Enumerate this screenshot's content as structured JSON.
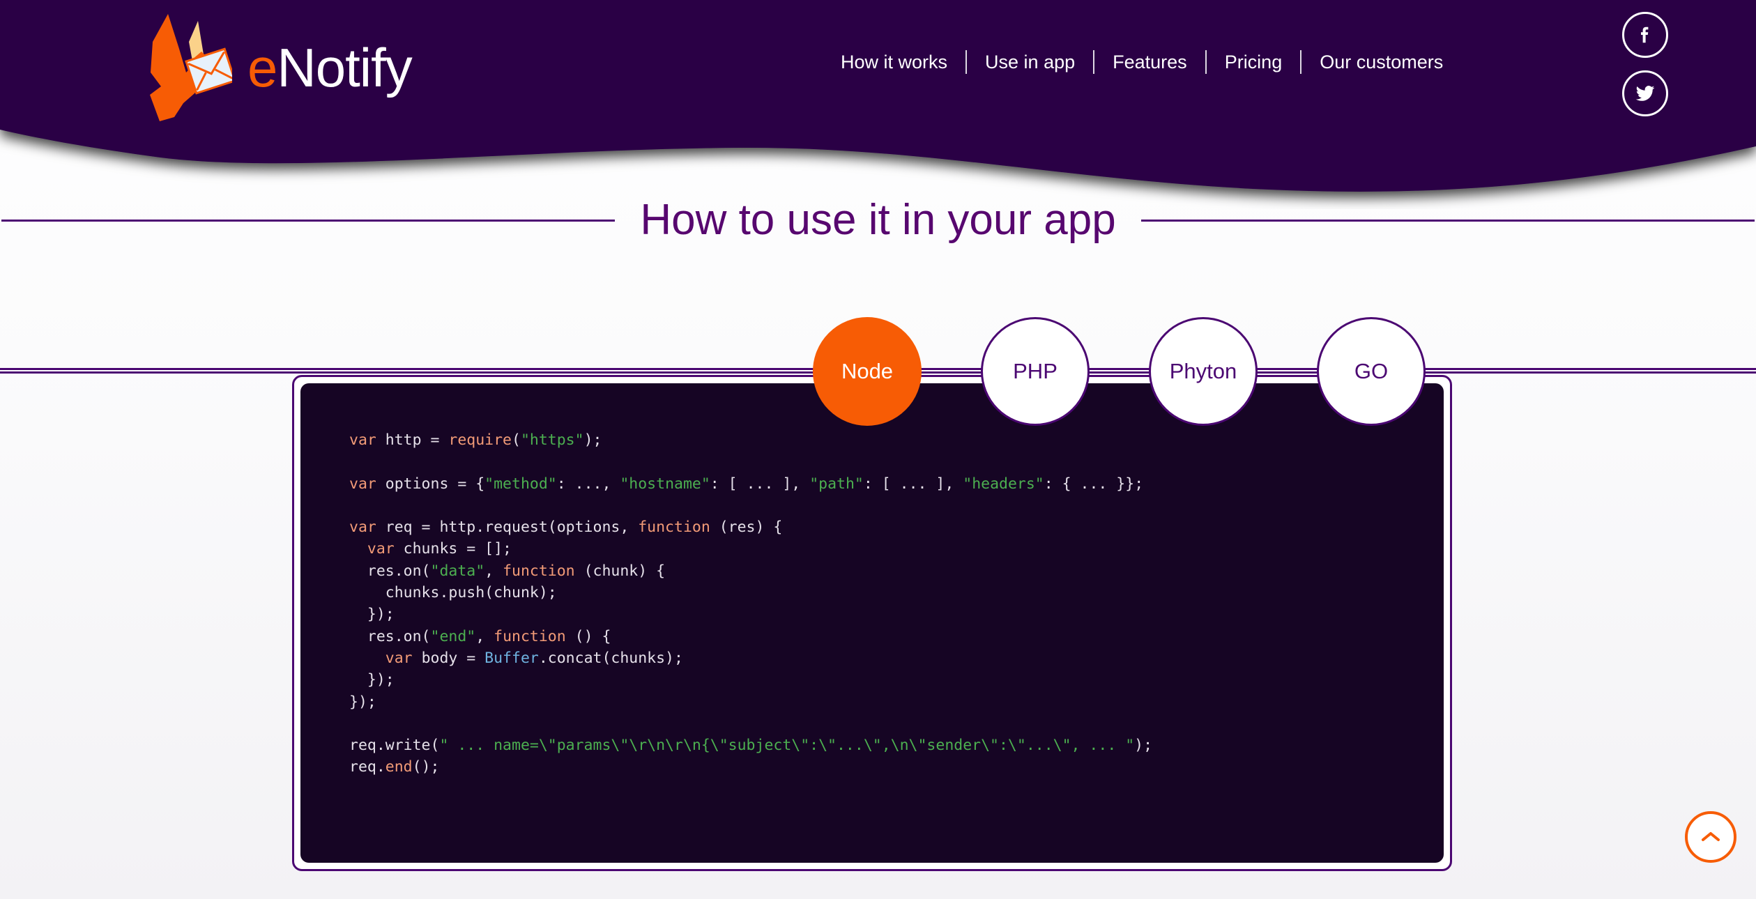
{
  "brand": {
    "prefix": "e",
    "name": "Notify",
    "logo_icon": "bird-with-envelope-logo"
  },
  "nav": {
    "items": [
      {
        "label": "How it works"
      },
      {
        "label": "Use in app"
      },
      {
        "label": "Features"
      },
      {
        "label": "Pricing"
      },
      {
        "label": "Our customers"
      }
    ]
  },
  "socials": [
    {
      "icon": "facebook-icon",
      "label": "Facebook"
    },
    {
      "icon": "twitter-icon",
      "label": "Twitter"
    }
  ],
  "section": {
    "title": "How to use it in your app"
  },
  "tabs": {
    "items": [
      {
        "label": "Node",
        "active": true
      },
      {
        "label": "PHP",
        "active": false
      },
      {
        "label": "Phyton",
        "active": false
      },
      {
        "label": "GO",
        "active": false
      }
    ]
  },
  "code": {
    "language": "Node",
    "lines": [
      [
        {
          "t": "var ",
          "c": "k"
        },
        {
          "t": "http = ",
          "c": "pl"
        },
        {
          "t": "require",
          "c": "k"
        },
        {
          "t": "(",
          "c": "pl"
        },
        {
          "t": "\"https\"",
          "c": "s"
        },
        {
          "t": ");",
          "c": "pl"
        }
      ],
      [],
      [
        {
          "t": "var ",
          "c": "k"
        },
        {
          "t": "options = {",
          "c": "pl"
        },
        {
          "t": "\"method\"",
          "c": "s"
        },
        {
          "t": ": ..., ",
          "c": "pl"
        },
        {
          "t": "\"hostname\"",
          "c": "s"
        },
        {
          "t": ": [ ... ], ",
          "c": "pl"
        },
        {
          "t": "\"path\"",
          "c": "s"
        },
        {
          "t": ": [ ... ], ",
          "c": "pl"
        },
        {
          "t": "\"headers\"",
          "c": "s"
        },
        {
          "t": ": { ... }};",
          "c": "pl"
        }
      ],
      [],
      [
        {
          "t": "var ",
          "c": "k"
        },
        {
          "t": "req = http.request(options, ",
          "c": "pl"
        },
        {
          "t": "function",
          "c": "k"
        },
        {
          "t": " (res) {",
          "c": "pl"
        }
      ],
      [
        {
          "t": "  ",
          "c": "pl"
        },
        {
          "t": "var ",
          "c": "k"
        },
        {
          "t": "chunks = [];",
          "c": "pl"
        }
      ],
      [
        {
          "t": "  res.on(",
          "c": "pl"
        },
        {
          "t": "\"data\"",
          "c": "s"
        },
        {
          "t": ", ",
          "c": "pl"
        },
        {
          "t": "function",
          "c": "k"
        },
        {
          "t": " (chunk) {",
          "c": "pl"
        }
      ],
      [
        {
          "t": "    chunks.push(chunk);",
          "c": "pl"
        }
      ],
      [
        {
          "t": "  });",
          "c": "pl"
        }
      ],
      [
        {
          "t": "  res.on(",
          "c": "pl"
        },
        {
          "t": "\"end\"",
          "c": "s"
        },
        {
          "t": ", ",
          "c": "pl"
        },
        {
          "t": "function",
          "c": "k"
        },
        {
          "t": " () {",
          "c": "pl"
        }
      ],
      [
        {
          "t": "    ",
          "c": "pl"
        },
        {
          "t": "var ",
          "c": "k"
        },
        {
          "t": "body = ",
          "c": "pl"
        },
        {
          "t": "Buffer",
          "c": "b"
        },
        {
          "t": ".concat(chunks);",
          "c": "pl"
        }
      ],
      [
        {
          "t": "  });",
          "c": "pl"
        }
      ],
      [
        {
          "t": "});",
          "c": "pl"
        }
      ],
      [],
      [
        {
          "t": "req.write(",
          "c": "pl"
        },
        {
          "t": "\" ... name=\\\"params\\\"\\r\\n\\r\\n{\\\"subject\\\":\\\"...\\\",\\n\\\"sender\\\":\\\"...\\\", ... \"",
          "c": "s"
        },
        {
          "t": ");",
          "c": "pl"
        }
      ],
      [
        {
          "t": "req.",
          "c": "pl"
        },
        {
          "t": "end",
          "c": "k"
        },
        {
          "t": "();",
          "c": "pl"
        }
      ]
    ]
  },
  "scroll_top": {
    "icon": "chevron-up-icon",
    "label": "Back to top"
  },
  "colors": {
    "header_purple": "#2a0645",
    "accent_orange": "#f75c05",
    "title_purple": "#57076f",
    "border_purple": "#4b0772",
    "code_bg": "#160524",
    "string_green": "#4caf50",
    "keyword_orange": "#f29b77",
    "type_blue": "#6fb3e0"
  }
}
